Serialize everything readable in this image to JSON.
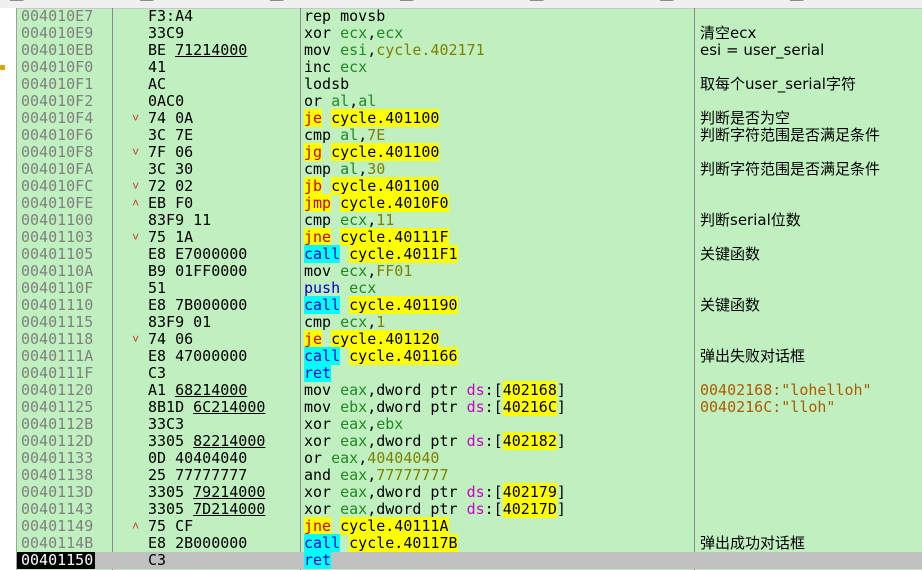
{
  "toolbar": {
    "segments": [
      "──",
      "──",
      "──",
      "──",
      "──",
      "──",
      "──"
    ]
  },
  "rows": [
    {
      "addr": "004010E7",
      "mark": "",
      "bytes": "F3:A4",
      "bytes_ref": "",
      "parts": [
        [
          "kw",
          "rep movsb"
        ]
      ],
      "comment": ""
    },
    {
      "addr": "004010E9",
      "mark": "",
      "bytes": "33C9",
      "bytes_ref": "",
      "parts": [
        [
          "kw",
          "xor "
        ],
        [
          "reg",
          "ecx"
        ],
        [
          "op",
          ","
        ],
        [
          "reg",
          "ecx"
        ]
      ],
      "comment": "清空ecx"
    },
    {
      "addr": "004010EB",
      "mark": "",
      "bytes": "BE ",
      "bytes_ref": "71214000",
      "parts": [
        [
          "kw",
          "mov "
        ],
        [
          "reg",
          "esi"
        ],
        [
          "op",
          ","
        ],
        [
          "num",
          "cycle.402171"
        ]
      ],
      "comment": "esi = user_serial"
    },
    {
      "addr": "004010F0",
      "mark": "",
      "bytes": "41",
      "bytes_ref": "",
      "parts": [
        [
          "kw",
          "inc "
        ],
        [
          "reg",
          "ecx"
        ]
      ],
      "comment": ""
    },
    {
      "addr": "004010F1",
      "mark": "",
      "bytes": "AC",
      "bytes_ref": "",
      "parts": [
        [
          "kw",
          "lodsb"
        ]
      ],
      "comment": "取每个user_serial字符"
    },
    {
      "addr": "004010F2",
      "mark": "",
      "bytes": "0AC0",
      "bytes_ref": "",
      "parts": [
        [
          "kw",
          "or "
        ],
        [
          "reg",
          "al"
        ],
        [
          "op",
          ","
        ],
        [
          "reg",
          "al"
        ]
      ],
      "comment": ""
    },
    {
      "addr": "004010F4",
      "mark": "v",
      "bytes": "74 0A",
      "bytes_ref": "",
      "parts": [
        [
          "jump",
          "je"
        ],
        [
          "op",
          " "
        ],
        [
          "tgt",
          "cycle.401100"
        ]
      ],
      "comment": "判断是否为空"
    },
    {
      "addr": "004010F6",
      "mark": "",
      "bytes": "3C 7E",
      "bytes_ref": "",
      "parts": [
        [
          "kw",
          "cmp "
        ],
        [
          "reg",
          "al"
        ],
        [
          "op",
          ","
        ],
        [
          "num",
          "7E"
        ]
      ],
      "comment": "判断字符范围是否满足条件"
    },
    {
      "addr": "004010F8",
      "mark": "v",
      "bytes": "7F 06",
      "bytes_ref": "",
      "parts": [
        [
          "jump",
          "jg"
        ],
        [
          "op",
          " "
        ],
        [
          "tgt",
          "cycle.401100"
        ]
      ],
      "comment": ""
    },
    {
      "addr": "004010FA",
      "mark": "",
      "bytes": "3C 30",
      "bytes_ref": "",
      "parts": [
        [
          "kw",
          "cmp "
        ],
        [
          "reg",
          "al"
        ],
        [
          "op",
          ","
        ],
        [
          "num",
          "30"
        ]
      ],
      "comment": "判断字符范围是否满足条件"
    },
    {
      "addr": "004010FC",
      "mark": "v",
      "bytes": "72 02",
      "bytes_ref": "",
      "parts": [
        [
          "jump",
          "jb"
        ],
        [
          "op",
          " "
        ],
        [
          "tgt",
          "cycle.401100"
        ]
      ],
      "comment": ""
    },
    {
      "addr": "004010FE",
      "mark": "^",
      "bytes": "EB F0",
      "bytes_ref": "",
      "parts": [
        [
          "jump",
          "jmp"
        ],
        [
          "op",
          " "
        ],
        [
          "tgt",
          "cycle.4010F0"
        ]
      ],
      "comment": ""
    },
    {
      "addr": "00401100",
      "mark": "",
      "bytes": "83F9 11",
      "bytes_ref": "",
      "parts": [
        [
          "kw",
          "cmp "
        ],
        [
          "reg",
          "ecx"
        ],
        [
          "op",
          ","
        ],
        [
          "num",
          "11"
        ]
      ],
      "comment": "判断serial位数"
    },
    {
      "addr": "00401103",
      "mark": "v",
      "bytes": "75 1A",
      "bytes_ref": "",
      "parts": [
        [
          "jump",
          "jne"
        ],
        [
          "op",
          " "
        ],
        [
          "tgt",
          "cycle.40111F"
        ]
      ],
      "comment": ""
    },
    {
      "addr": "00401105",
      "mark": "",
      "bytes": "E8 E7000000",
      "bytes_ref": "",
      "parts": [
        [
          "call",
          "call"
        ],
        [
          "op",
          " "
        ],
        [
          "tgt",
          "cycle.4011F1"
        ]
      ],
      "comment": "关键函数"
    },
    {
      "addr": "0040110A",
      "mark": "",
      "bytes": "B9 01FF0000",
      "bytes_ref": "",
      "parts": [
        [
          "kw",
          "mov "
        ],
        [
          "reg",
          "ecx"
        ],
        [
          "op",
          ","
        ],
        [
          "num",
          "FF01"
        ]
      ],
      "comment": ""
    },
    {
      "addr": "0040110F",
      "mark": "",
      "bytes": "51",
      "bytes_ref": "",
      "parts": [
        [
          "push",
          "push "
        ],
        [
          "reg",
          "ecx"
        ]
      ],
      "comment": ""
    },
    {
      "addr": "00401110",
      "mark": "",
      "bytes": "E8 7B000000",
      "bytes_ref": "",
      "parts": [
        [
          "call",
          "call"
        ],
        [
          "op",
          " "
        ],
        [
          "tgt",
          "cycle.401190"
        ]
      ],
      "comment": "关键函数"
    },
    {
      "addr": "00401115",
      "mark": "",
      "bytes": "83F9 01",
      "bytes_ref": "",
      "parts": [
        [
          "kw",
          "cmp "
        ],
        [
          "reg",
          "ecx"
        ],
        [
          "op",
          ","
        ],
        [
          "num",
          "1"
        ]
      ],
      "comment": ""
    },
    {
      "addr": "00401118",
      "mark": "v",
      "bytes": "74 06",
      "bytes_ref": "",
      "parts": [
        [
          "jump",
          "je"
        ],
        [
          "op",
          " "
        ],
        [
          "tgt",
          "cycle.401120"
        ]
      ],
      "comment": ""
    },
    {
      "addr": "0040111A",
      "mark": "",
      "bytes": "E8 47000000",
      "bytes_ref": "",
      "parts": [
        [
          "call",
          "call"
        ],
        [
          "op",
          " "
        ],
        [
          "tgt",
          "cycle.401166"
        ]
      ],
      "comment": "弹出失败对话框"
    },
    {
      "addr": "0040111F",
      "mark": "",
      "bytes": "C3",
      "bytes_ref": "",
      "parts": [
        [
          "ret",
          "ret"
        ]
      ],
      "comment": ""
    },
    {
      "addr": "00401120",
      "mark": "",
      "bytes": "A1 ",
      "bytes_ref": "68214000",
      "parts": [
        [
          "kw",
          "mov "
        ],
        [
          "reg",
          "eax"
        ],
        [
          "op",
          ","
        ],
        [
          "kw",
          "dword ptr "
        ],
        [
          "seg",
          "ds"
        ],
        [
          "op",
          ":["
        ],
        [
          "tgtc",
          "402168"
        ],
        [
          "op",
          "]"
        ]
      ],
      "comment": "00402168:\"lohelloh\"",
      "comment_str": true
    },
    {
      "addr": "00401125",
      "mark": "",
      "bytes": "8B1D ",
      "bytes_ref": "6C214000",
      "parts": [
        [
          "kw",
          "mov "
        ],
        [
          "reg",
          "ebx"
        ],
        [
          "op",
          ","
        ],
        [
          "kw",
          "dword ptr "
        ],
        [
          "seg",
          "ds"
        ],
        [
          "op",
          ":["
        ],
        [
          "tgtc",
          "40216C"
        ],
        [
          "op",
          "]"
        ]
      ],
      "comment": "0040216C:\"lloh\"",
      "comment_str": true
    },
    {
      "addr": "0040112B",
      "mark": "",
      "bytes": "33C3",
      "bytes_ref": "",
      "parts": [
        [
          "kw",
          "xor "
        ],
        [
          "reg",
          "eax"
        ],
        [
          "op",
          ","
        ],
        [
          "reg",
          "ebx"
        ]
      ],
      "comment": ""
    },
    {
      "addr": "0040112D",
      "mark": "",
      "bytes": "3305 ",
      "bytes_ref": "82214000",
      "parts": [
        [
          "kw",
          "xor "
        ],
        [
          "reg",
          "eax"
        ],
        [
          "op",
          ","
        ],
        [
          "kw",
          "dword ptr "
        ],
        [
          "seg",
          "ds"
        ],
        [
          "op",
          ":["
        ],
        [
          "tgtc",
          "402182"
        ],
        [
          "op",
          "]"
        ]
      ],
      "comment": ""
    },
    {
      "addr": "00401133",
      "mark": "",
      "bytes": "0D 40404040",
      "bytes_ref": "",
      "parts": [
        [
          "kw",
          "or "
        ],
        [
          "reg",
          "eax"
        ],
        [
          "op",
          ","
        ],
        [
          "num",
          "40404040"
        ]
      ],
      "comment": ""
    },
    {
      "addr": "00401138",
      "mark": "",
      "bytes": "25 77777777",
      "bytes_ref": "",
      "parts": [
        [
          "kw",
          "and "
        ],
        [
          "reg",
          "eax"
        ],
        [
          "op",
          ","
        ],
        [
          "num",
          "77777777"
        ]
      ],
      "comment": ""
    },
    {
      "addr": "0040113D",
      "mark": "",
      "bytes": "3305 ",
      "bytes_ref": "79214000",
      "parts": [
        [
          "kw",
          "xor "
        ],
        [
          "reg",
          "eax"
        ],
        [
          "op",
          ","
        ],
        [
          "kw",
          "dword ptr "
        ],
        [
          "seg",
          "ds"
        ],
        [
          "op",
          ":["
        ],
        [
          "tgtc",
          "402179"
        ],
        [
          "op",
          "]"
        ]
      ],
      "comment": ""
    },
    {
      "addr": "00401143",
      "mark": "",
      "bytes": "3305 ",
      "bytes_ref": "7D214000",
      "parts": [
        [
          "kw",
          "xor "
        ],
        [
          "reg",
          "eax"
        ],
        [
          "op",
          ","
        ],
        [
          "kw",
          "dword ptr "
        ],
        [
          "seg",
          "ds"
        ],
        [
          "op",
          ":["
        ],
        [
          "tgtc",
          "40217D"
        ],
        [
          "op",
          "]"
        ]
      ],
      "comment": ""
    },
    {
      "addr": "00401149",
      "mark": "^",
      "bytes": "75 CF",
      "bytes_ref": "",
      "parts": [
        [
          "jump",
          "jne"
        ],
        [
          "op",
          " "
        ],
        [
          "tgt",
          "cycle.40111A"
        ]
      ],
      "comment": ""
    },
    {
      "addr": "0040114B",
      "mark": "",
      "bytes": "E8 2B000000",
      "bytes_ref": "",
      "parts": [
        [
          "call",
          "call"
        ],
        [
          "op",
          " "
        ],
        [
          "tgt",
          "cycle.40117B"
        ]
      ],
      "comment": "弹出成功对话框"
    },
    {
      "addr": "00401150",
      "mark": "",
      "bytes": "C3",
      "bytes_ref": "",
      "parts": [
        [
          "ret",
          "ret"
        ]
      ],
      "comment": "",
      "selected": true
    }
  ],
  "gutter_markers": [
    3
  ],
  "colors": {
    "background": "#c0f0c0",
    "jump_highlight": "#ffff00",
    "call_highlight": "#00ffff",
    "string_comment": "#b05a00"
  }
}
